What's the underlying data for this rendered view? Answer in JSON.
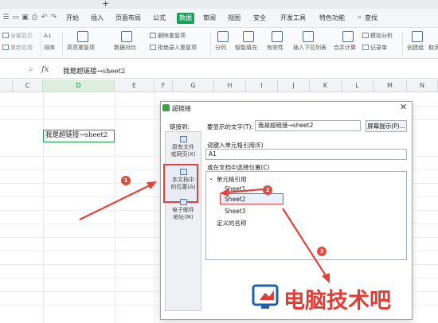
{
  "window": {
    "new_tab_glyph": "+"
  },
  "menubar": {
    "quick_icons": [
      "open-folder-icon",
      "save-icon",
      "print-icon",
      "undo-icon",
      "redo-icon"
    ],
    "tabs": [
      {
        "label": "开始",
        "active": false
      },
      {
        "label": "插入",
        "active": false
      },
      {
        "label": "页面布局",
        "active": false
      },
      {
        "label": "公式",
        "active": false
      },
      {
        "label": "数据",
        "active": true
      },
      {
        "label": "审阅",
        "active": false
      },
      {
        "label": "视图",
        "active": false
      },
      {
        "label": "安全",
        "active": false
      },
      {
        "label": "开发工具",
        "active": false
      },
      {
        "label": "特色功能",
        "active": false
      }
    ],
    "search_label": "查找"
  },
  "ribbon": {
    "show_all": "全部显示",
    "reapply": "重新应用",
    "sort": "排序",
    "highlight_duplicates": "高亮重复项",
    "data_compare": "数据对比",
    "delete_duplicates": "删除重复项",
    "reject_duplicates": "拒绝录入重复项",
    "split": "分列",
    "smart_fill": "智能填充",
    "validity": "有效性",
    "insert_dropdown": "插入下拉列表",
    "merge_calc": "合并计算",
    "simulation": "模拟分析",
    "record_form": "记录单",
    "create_group": "创建组",
    "ungroup": "取消"
  },
  "formula_bar": {
    "zoom_icon": "magnifier-icon",
    "fx": "fx",
    "content": "我是超链接→sheet2"
  },
  "grid": {
    "columns": [
      "C",
      "D",
      "E",
      "F",
      "G",
      "H",
      "I",
      "J",
      "K",
      "L",
      "M",
      "N"
    ],
    "selected_column": "D",
    "active_cell_text": "我是超链接→sheet2"
  },
  "dialog": {
    "title": "超链接",
    "link_to_label": "链接到:",
    "display_text_label": "要显示的文字(T):",
    "display_text_value": "我是超链接→sheet2",
    "screen_tip_button": "屏幕提示(P)...",
    "sidebar": [
      {
        "label_line1": "原有文件",
        "label_line2": "或网页(X)",
        "icon": "web-page-icon"
      },
      {
        "label_line1": "本文档中",
        "label_line2": "的位置(A)",
        "icon": "document-place-icon"
      },
      {
        "label_line1": "电子邮件",
        "label_line2": "地址(M)",
        "icon": "email-icon"
      }
    ],
    "cell_ref_label": "请键入单元格引用(E)",
    "cell_ref_value": "A1",
    "location_label": "或在文档中选择位置(C)",
    "tree": {
      "root": "单元格引用",
      "sheets": [
        "Sheet1",
        "Sheet2",
        "Sheet3"
      ],
      "selected": "Sheet2",
      "defined_names": "定义的名称"
    }
  },
  "annotations": {
    "steps": [
      "1",
      "2",
      "3"
    ],
    "color": "#e24a3e"
  },
  "watermark": {
    "text": "电脑技术吧"
  },
  "colors": {
    "accent_green": "#18a058",
    "selection_green": "#1e9b52",
    "annotation_red": "#e0433c"
  }
}
